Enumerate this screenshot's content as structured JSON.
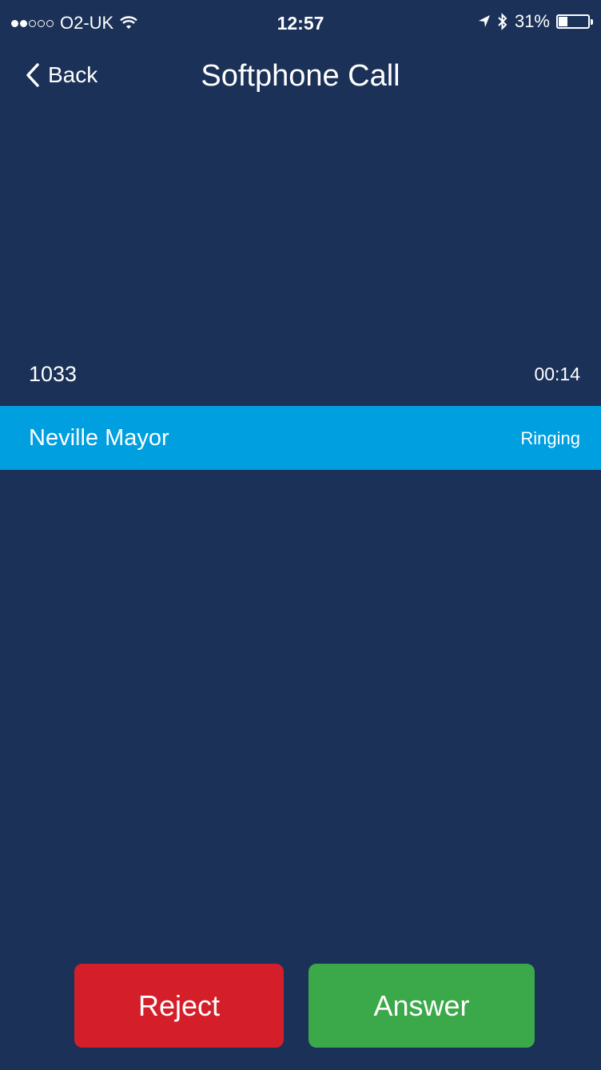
{
  "status_bar": {
    "carrier": "O2-UK",
    "time": "12:57",
    "battery": "31%",
    "battery_level": 0.31,
    "signal_bars_filled": 2,
    "signal_bars_total": 5,
    "icons": [
      "wifi-icon",
      "location-arrow-icon",
      "bluetooth-icon",
      "battery-icon"
    ]
  },
  "nav": {
    "back_label": "Back",
    "title": "Softphone Call"
  },
  "call": {
    "number": "1033",
    "duration": "00:14",
    "caller_name": "Neville Mayor",
    "status": "Ringing"
  },
  "actions": {
    "reject_label": "Reject",
    "answer_label": "Answer"
  },
  "colors": {
    "background": "#1b3158",
    "highlight": "#009fe0",
    "reject": "#d41f2b",
    "answer": "#3ba84a"
  }
}
